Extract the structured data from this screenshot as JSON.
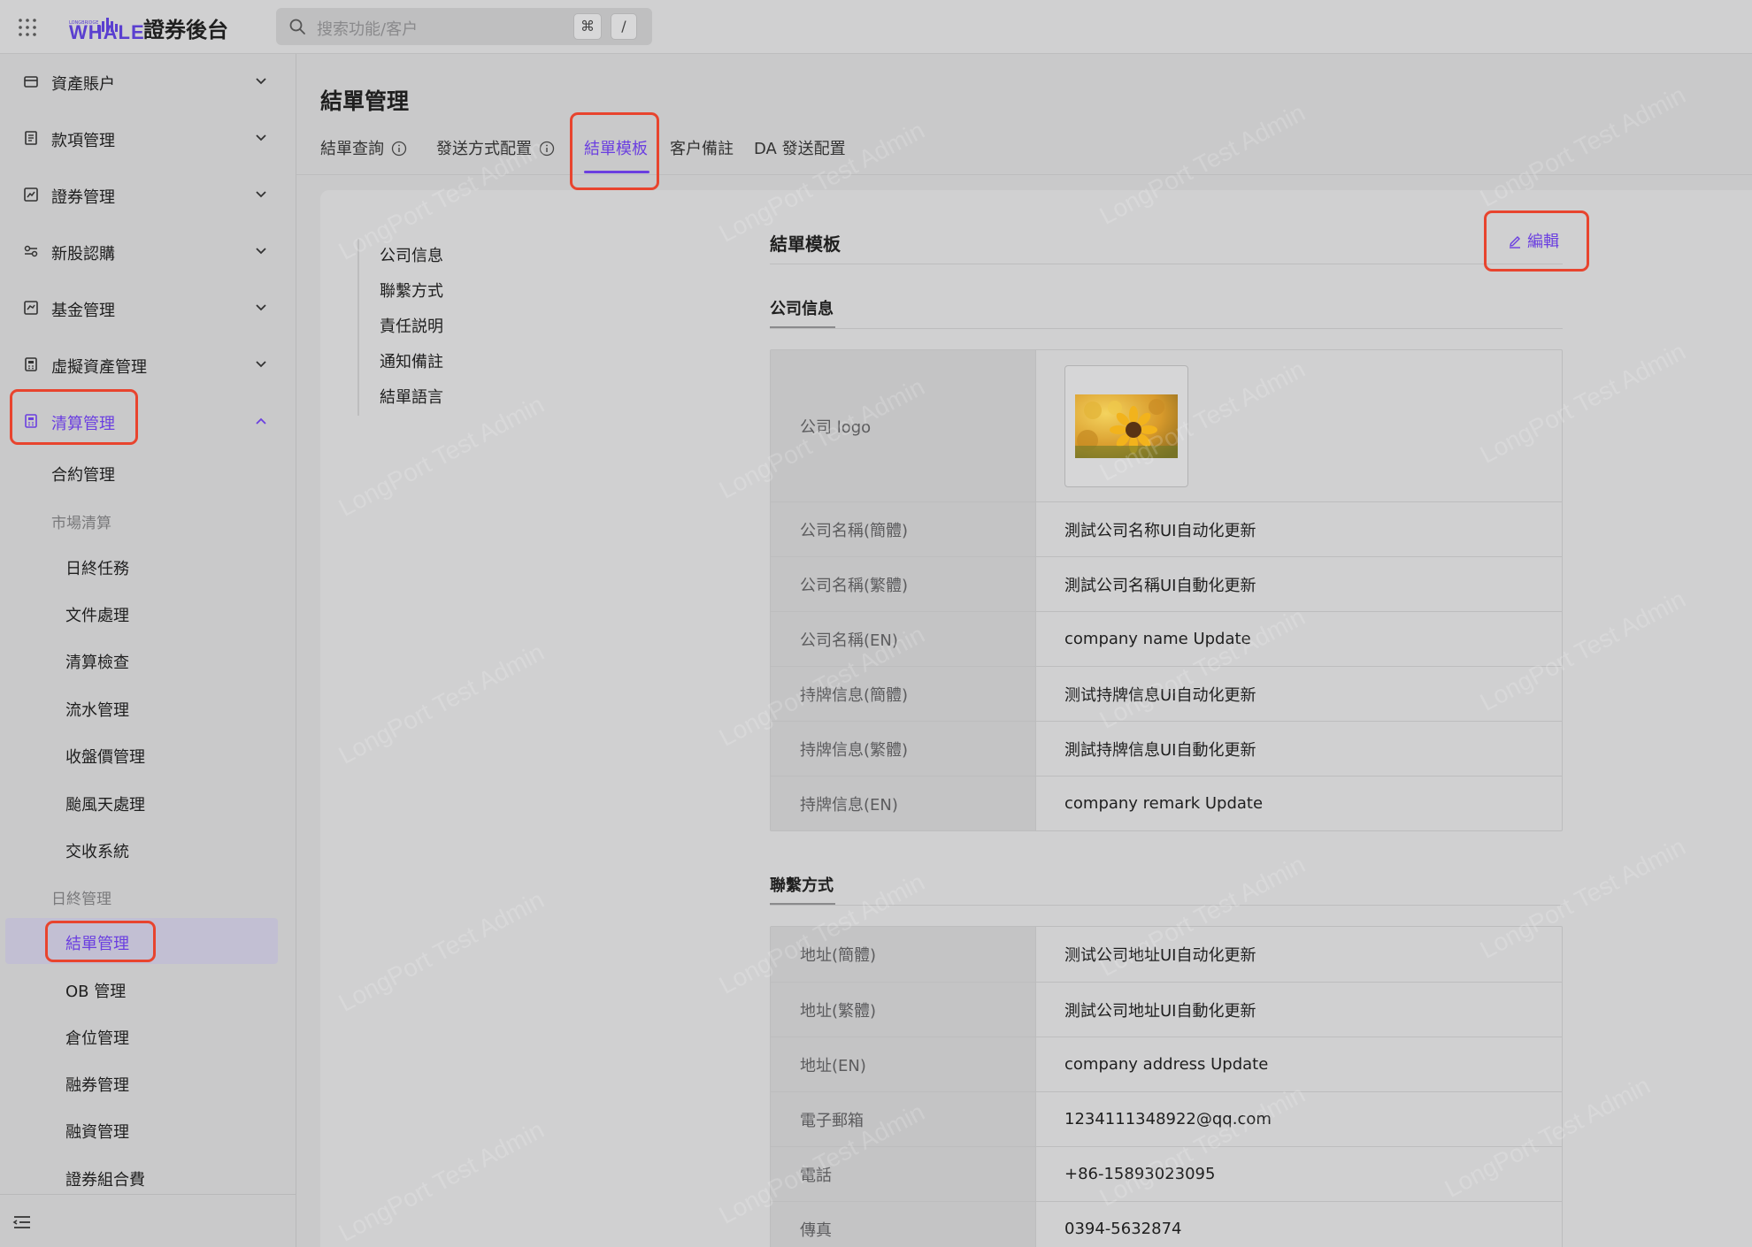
{
  "app": {
    "title": "證券後台",
    "logo_text": "WHALE",
    "logo_small_text": "LONGBRIDGE"
  },
  "search": {
    "placeholder": "搜索功能/客户",
    "shortcut_key_1": "⌘",
    "shortcut_key_2": "/"
  },
  "sidebar": {
    "menu": [
      {
        "label": "資產賬户",
        "icon": "wallet-icon"
      },
      {
        "label": "款項管理",
        "icon": "ledger-icon"
      },
      {
        "label": "證券管理",
        "icon": "chart-box-icon"
      },
      {
        "label": "新股認購",
        "icon": "subscribe-icon"
      },
      {
        "label": "基金管理",
        "icon": "fund-icon"
      },
      {
        "label": "虛擬資產管理",
        "icon": "calculator-icon"
      },
      {
        "label": "清算管理",
        "icon": "clearing-icon"
      }
    ],
    "sub": {
      "contract": "合約管理",
      "group_market": "市場清算",
      "eod_task": "日終任務",
      "file_process": "文件處理",
      "clearing_check": "清算檢查",
      "flow_manage": "流水管理",
      "close_price": "收盤價管理",
      "typhoon": "颱風天處理",
      "settlement_system": "交收系統",
      "group_eod": "日終管理",
      "statement_manage": "結單管理",
      "ob_manage": "OB 管理",
      "position_manage": "倉位管理",
      "sec_lending": "融券管理",
      "margin_financing": "融資管理",
      "portfolio_fee": "證券組合費"
    }
  },
  "main": {
    "page_title": "結單管理",
    "tabs": [
      "結單查詢",
      "發送方式配置",
      "結單模板",
      "客户備註",
      "DA 發送配置"
    ],
    "anchors": [
      "公司信息",
      "聯繫方式",
      "責任説明",
      "通知備註",
      "結單語言"
    ],
    "section_title": "結單模板",
    "edit_label": "編輯",
    "company_section": {
      "title": "公司信息",
      "logo_label": "公司 logo",
      "rows": [
        {
          "label": "公司名稱(簡體)",
          "value": "測試公司名称UI自动化更新"
        },
        {
          "label": "公司名稱(繁體)",
          "value": "測試公司名稱UI自動化更新"
        },
        {
          "label": "公司名稱(EN)",
          "value": "company name Update"
        },
        {
          "label": "持牌信息(簡體)",
          "value": "测试持牌信息UI自动化更新"
        },
        {
          "label": "持牌信息(繁體)",
          "value": "測試持牌信息UI自動化更新"
        },
        {
          "label": "持牌信息(EN)",
          "value": "company remark Update"
        }
      ]
    },
    "contact_section": {
      "title": "聯繫方式",
      "rows": [
        {
          "label": "地址(簡體)",
          "value": "测试公司地址UI自动化更新"
        },
        {
          "label": "地址(繁體)",
          "value": "測試公司地址UI自動化更新"
        },
        {
          "label": "地址(EN)",
          "value": "company address Update"
        },
        {
          "label": "電子郵箱",
          "value": "1234111348922@qq.com"
        },
        {
          "label": "電話",
          "value": "+86-15893023095"
        },
        {
          "label": "傳真",
          "value": "0394-5632874"
        }
      ]
    }
  },
  "watermark": "LongPort Test Admin",
  "colors": {
    "accent": "#6b3fe0",
    "highlight": "#e8442e"
  }
}
